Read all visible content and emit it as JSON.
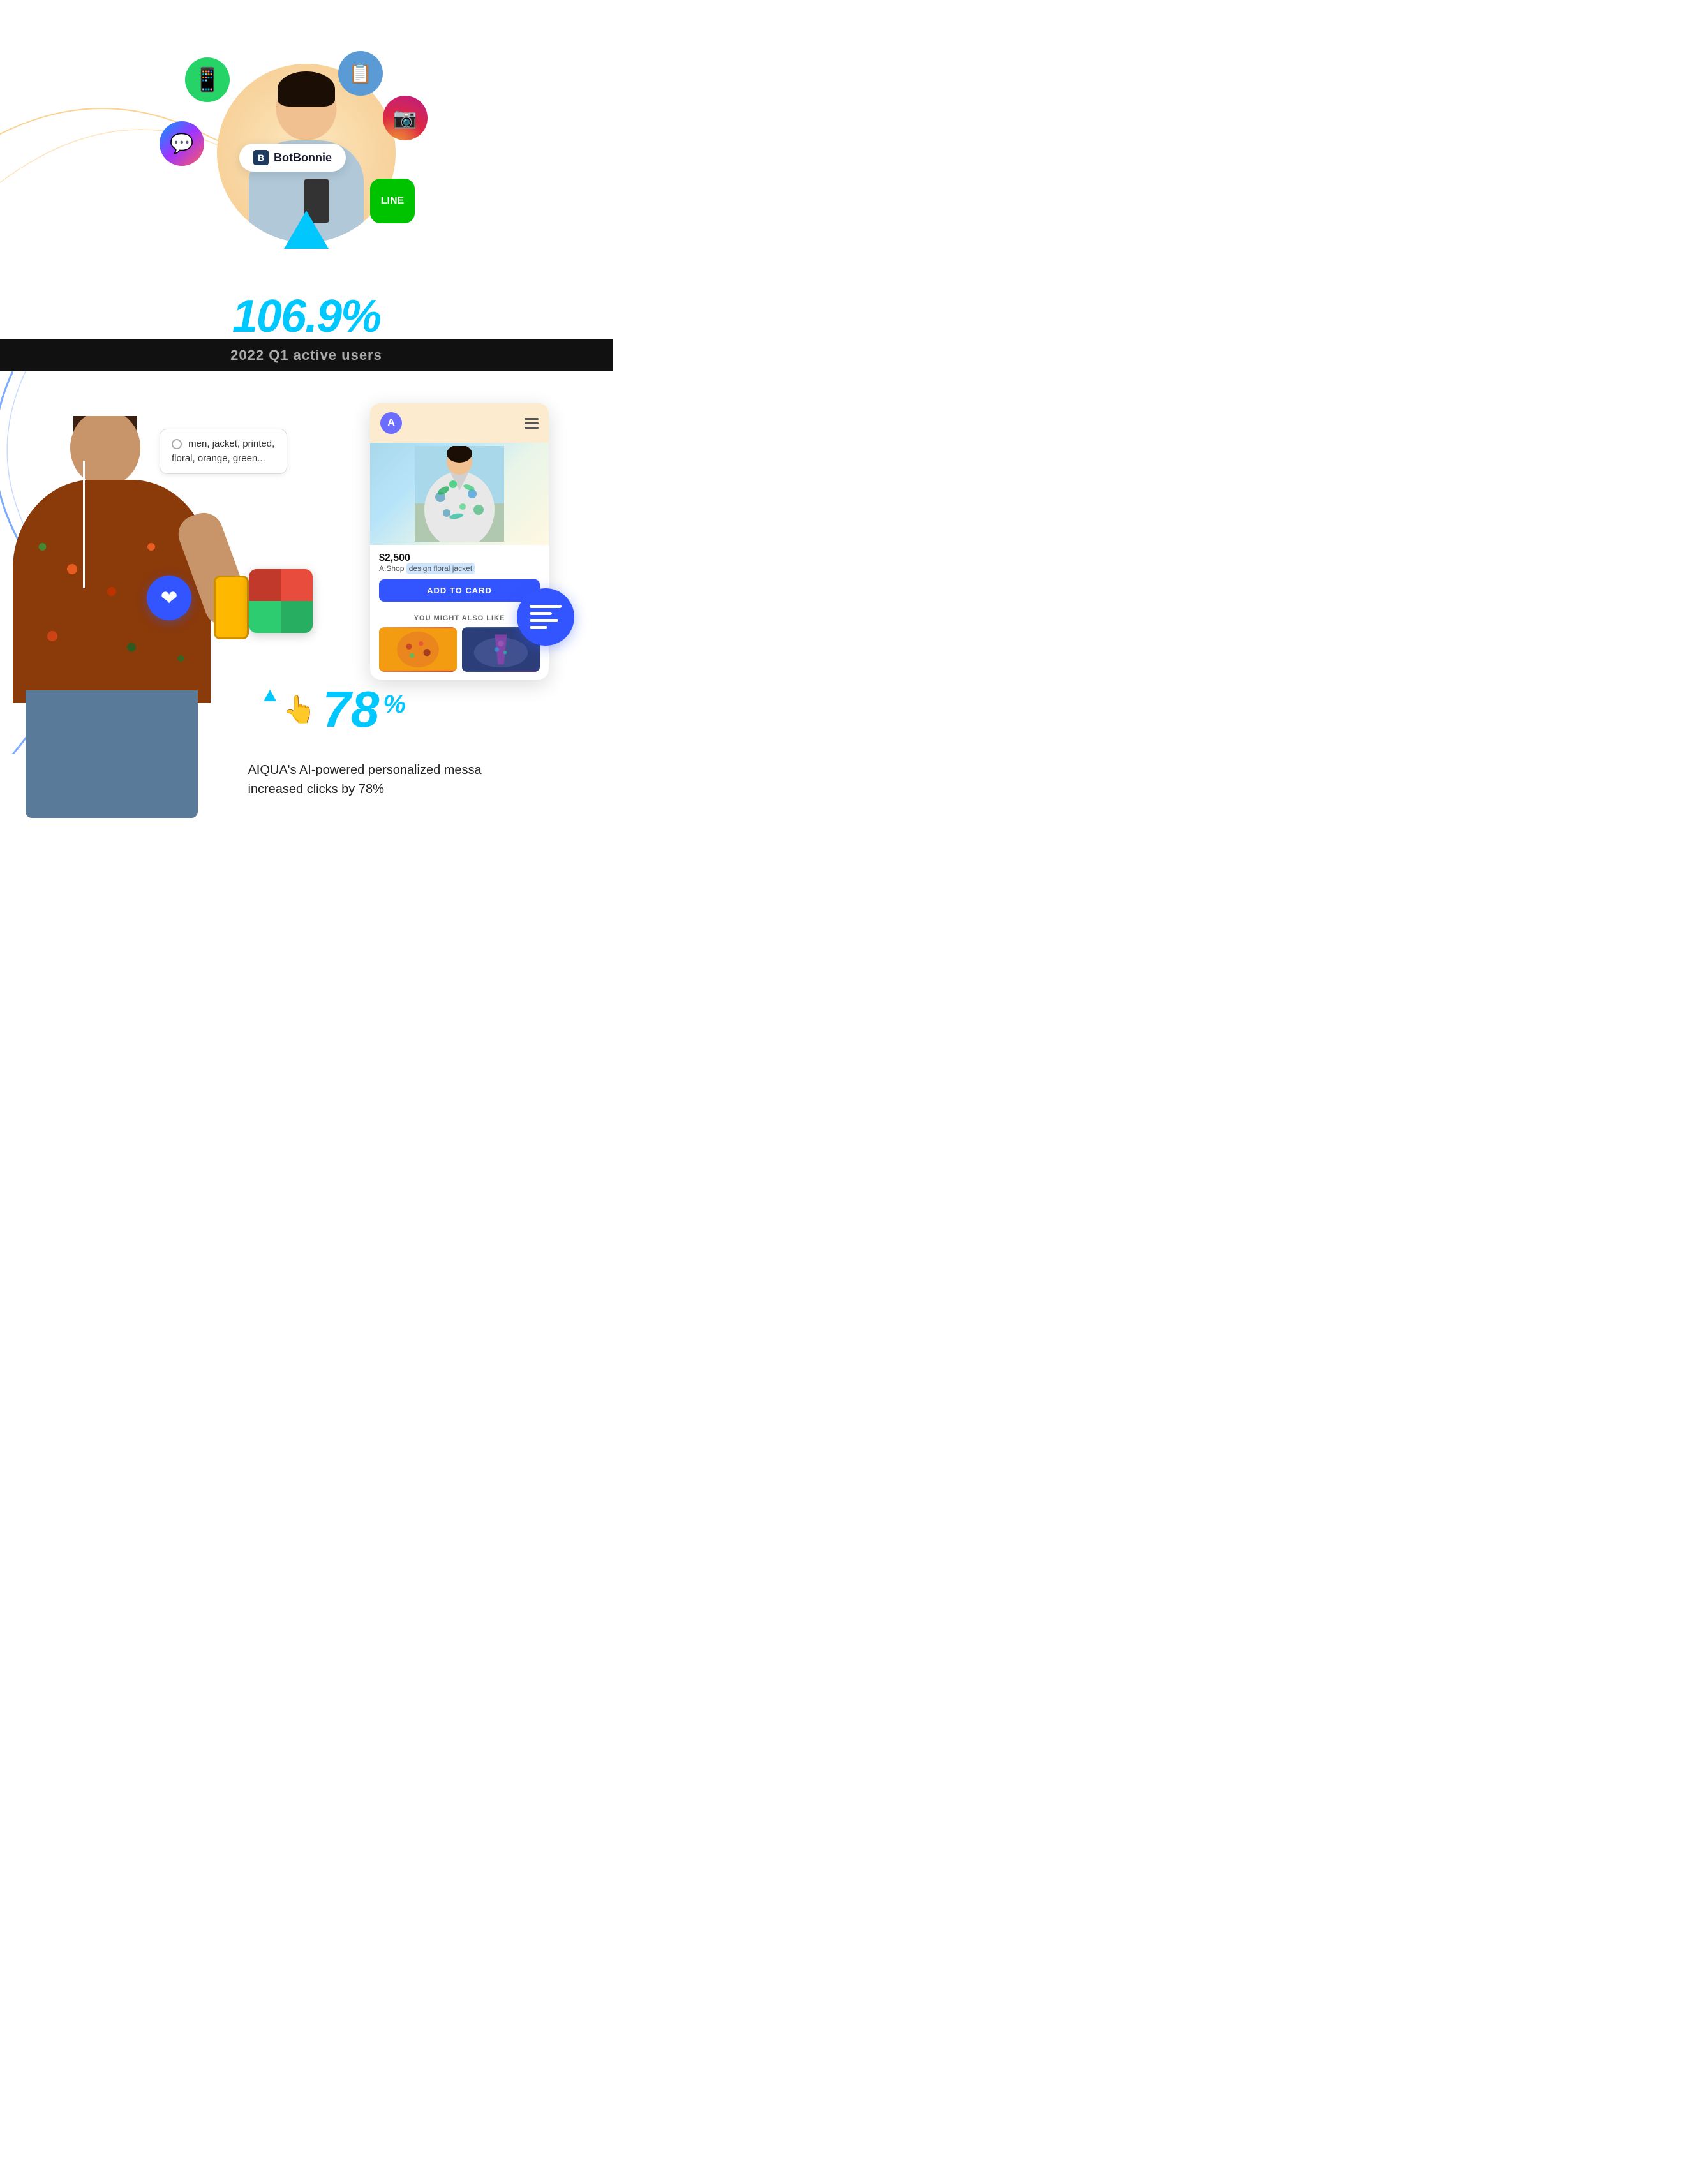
{
  "top": {
    "stat_value": "106.9",
    "stat_suffix": "%",
    "botbonnie_label": "BotBonnie",
    "icons": {
      "whatsapp": "💬",
      "messenger": "💬",
      "clipboard": "📋",
      "instagram": "📸",
      "line": "LINE"
    }
  },
  "divider": {
    "text": "2022 Q1 active users"
  },
  "bottom": {
    "chat_bubble_text": "men, jacket, printed, floral, orange, green...",
    "product": {
      "price": "$2,500",
      "shop": "A.Shop",
      "shop_tag": "design floral jacket",
      "add_to_card_label": "ADD TO CARD",
      "also_like_label": "YOU MIGHT ALSO LIKE"
    },
    "avatar_letter": "A",
    "stat_value": "78",
    "stat_suffix": "%",
    "description_line1": "AIQUA's AI-powered personalized messa",
    "description_line2": "increased clicks by 78%"
  }
}
